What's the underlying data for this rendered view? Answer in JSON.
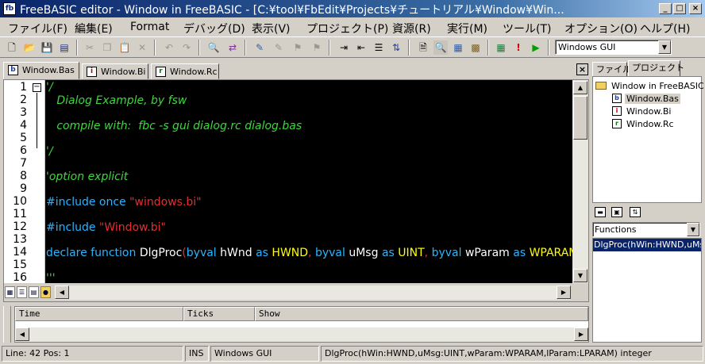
{
  "window": {
    "title": "FreeBASIC editor - Window in FreeBASIC - [C:¥tool¥FbEdit¥Projects¥チュートリアル¥Window¥Win...",
    "app_icon": "fb-app-icon",
    "minimize": "_",
    "maximize": "□",
    "close": "×"
  },
  "menu": [
    "ファイル(F)",
    "編集(E)",
    "Format",
    "デバッグ(D)",
    "表示(V)",
    "プロジェクト(P)",
    "資源(R)",
    "実行(M)",
    "ツール(T)",
    "オプション(O)",
    "ヘルプ(H)"
  ],
  "toolbar": {
    "build_option": "Windows GUI",
    "icons": [
      "new-file-icon",
      "open-icon",
      "save-icon",
      "save-all-icon",
      "cut-icon",
      "copy-icon",
      "paste-icon",
      "delete-icon",
      "undo-icon",
      "redo-icon",
      "find-icon",
      "replace-icon",
      "comment-icon",
      "uncomment-icon",
      "indent-icon",
      "outdent-icon",
      "bookmark-icon",
      "preview-icon",
      "properties-icon",
      "compile-icon",
      "build-icon",
      "run-icon"
    ]
  },
  "editor": {
    "tabs": [
      {
        "label": "Window.Bas",
        "icon": "b",
        "active": true
      },
      {
        "label": "Window.Bi",
        "icon": "i",
        "active": false
      },
      {
        "label": "Window.Rc",
        "icon": "r",
        "active": false
      }
    ],
    "close": "×",
    "fold_marker": "−",
    "line_numbers": [
      "1",
      "2",
      "3",
      "4",
      "5",
      "6",
      "7",
      "8",
      "9",
      "10",
      "11",
      "12",
      "13",
      "14",
      "15",
      "16"
    ],
    "code": {
      "l1": "'/",
      "l2": "   Dialog Example, by fsw",
      "l4": "   compile with:  fbc -s gui dialog.rc dialog.bas",
      "l6": "'/",
      "l8": "'option explicit",
      "l10_kw": "#include once ",
      "l10_str": "\"windows.bi\"",
      "l12_kw": "#include ",
      "l12_str": "\"Window.bi\"",
      "l14": {
        "t1": "declare function ",
        "t2": "DlgProc",
        "t3": "(",
        "t4": "byval ",
        "t5": "hWnd ",
        "t6": "as ",
        "t7": "HWND",
        "t8": ", ",
        "t9": "byval ",
        "t10": "uMsg ",
        "t11": "as ",
        "t12": "UINT",
        "t13": ", ",
        "t14": "byval ",
        "t15": "wParam ",
        "t16": "as ",
        "t17": "WPARAM"
      },
      "l16": "'''"
    }
  },
  "output": {
    "columns": [
      "Time",
      "Ticks",
      "Show"
    ]
  },
  "side_panel": {
    "tabs": [
      "ファイル",
      "プロジェクト"
    ],
    "project_name": "Window in FreeBASIC",
    "files": [
      {
        "label": "Window.Bas",
        "icon": "b"
      },
      {
        "label": "Window.Bi",
        "icon": "i"
      },
      {
        "label": "Window.Rc",
        "icon": "r"
      }
    ],
    "functions_dropdown": "Functions",
    "function_items": [
      "DlgProc(hWin:HWND,uMsg:UINT,wParam:WPARAM,lParam:LPARAM) integer"
    ]
  },
  "status": {
    "position": "Line: 42 Pos: 1",
    "mode": "INS",
    "build": "Windows GUI",
    "signature": "DlgProc(hWin:HWND,uMsg:UINT,wParam:WPARAM,lParam:LPARAM) integer"
  },
  "colors": {
    "titlebar": "#0a246a",
    "editor_bg": "#000000",
    "comment": "#3cd83c",
    "keyword": "#2ab4ff",
    "string": "#e03030",
    "type": "#ffff00"
  }
}
